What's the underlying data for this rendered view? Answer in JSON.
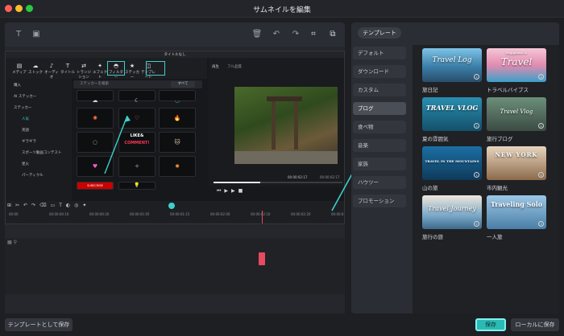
{
  "window": {
    "title": "サムネイルを編集"
  },
  "editor_shot": {
    "app_title": "タイトルなし",
    "toolbar": [
      "メディア",
      "ストック",
      "オーディオ",
      "タイトル",
      "トランジション",
      "エフェクト",
      "フィルター",
      "ステッカー",
      "テンプレート"
    ],
    "sidebar": [
      "購入",
      "AI ステッカー",
      "ステッカー",
      "人気",
      "英語",
      "ギラギラ",
      "スポーツ動画コンテスト",
      "星火",
      "パーティクル"
    ],
    "search_placeholder": "ステッカーを検索",
    "filter_all": "すべて",
    "player_label": "再生",
    "quality": "フル品質",
    "time_current": "00:00:02:17",
    "time_total": "00:00:02:17",
    "timeline_ticks": [
      "00:00",
      "00:00:00:10",
      "00:00:00:20",
      "00:00:01:05",
      "00:00:01:15",
      "00:00:02:00",
      "00:00:02:10",
      "00:00:02:20",
      "00:00:03:05"
    ],
    "sticker_labels": [
      "LIKE&",
      "COMMENT!",
      "SUBSCRIBE"
    ]
  },
  "right_panel": {
    "tab": "テンプレート",
    "categories": [
      "デフォルト",
      "ダウンロード",
      "カスタム",
      "ブログ",
      "食べ物",
      "音楽",
      "家族",
      "ハウツー",
      "プロモーション"
    ],
    "active_category": "ブログ",
    "templates": [
      {
        "label": "旅日記",
        "art": "Travel Log"
      },
      {
        "label": "トラベルバイブス",
        "art": "Travel"
      },
      {
        "label": "夏の雰囲気",
        "art": "TRAVEL VLOG"
      },
      {
        "label": "旅行ブログ",
        "art": "Travel Vlog"
      },
      {
        "label": "山の旅",
        "art": ""
      },
      {
        "label": "市内観光",
        "art": "NEW YORK"
      },
      {
        "label": "旅行の旅",
        "art": "Travel Journey"
      },
      {
        "label": "一人旅",
        "art": "Traveling Solo"
      }
    ],
    "art_small": {
      "travel_sub": "Happiness is",
      "mountain_badge": "TRAVEL IN THE MOUNTAINS"
    }
  },
  "footer": {
    "save_as_template": "テンプレートとして保存",
    "save": "保存",
    "save_local": "ローカルに保存"
  },
  "colors": {
    "accent": "#3ecfc9",
    "timeline_marker": "#e84a5f"
  }
}
